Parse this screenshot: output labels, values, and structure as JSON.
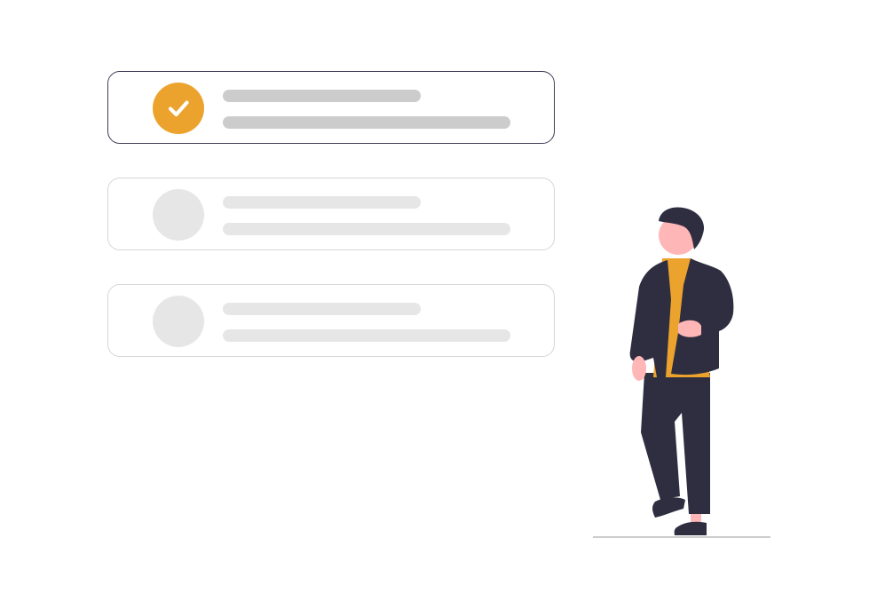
{
  "palette": {
    "accent": "#eca32d",
    "dark": "#2f2e41",
    "outline": "#3f3d56",
    "skin": "#ffb6b6",
    "placeholder": "#e6e6e6",
    "placeholder_selected": "#cccccc",
    "border_muted": "#d6d6d6",
    "ground": "#cccccc"
  },
  "options": [
    {
      "state": "selected",
      "icon": "check-icon"
    },
    {
      "state": "unselected",
      "icon": "empty-circle"
    },
    {
      "state": "unselected",
      "icon": "empty-circle"
    }
  ],
  "illustration": {
    "subject": "person-standing",
    "shirt_color": "#eca32d",
    "jacket_color": "#2f2e41"
  }
}
